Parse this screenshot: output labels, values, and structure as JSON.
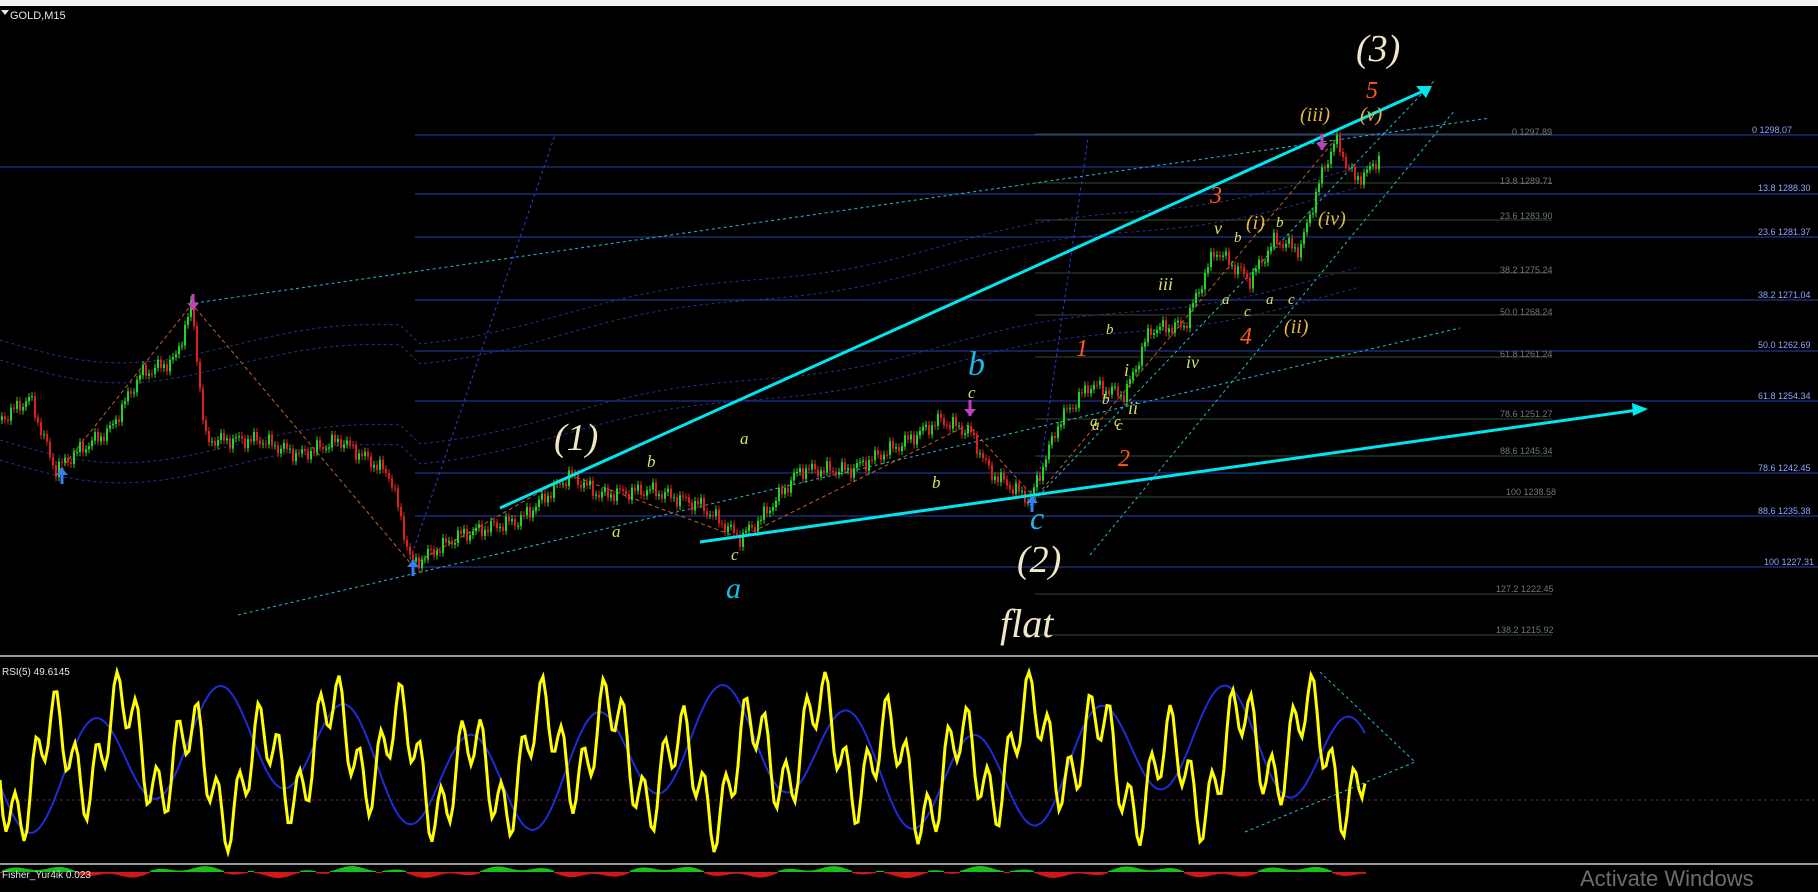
{
  "window": {
    "chart_title": "GOLD,M15",
    "rsi_title": "RSI(5) 49.6145",
    "fisher_title": "Fisher_Yur4ik 0.023",
    "watermark": "Activate Windows"
  },
  "colors": {
    "background": "#000000",
    "price_level_line": "#2c3fb0",
    "trend_channel": "#00e5ee",
    "rsi_line": "#ffff00",
    "wave_white": "#f0e6c8",
    "wave_blue": "#1cb8e8",
    "wave_orange": "#ff5a1e",
    "wave_yellow": "#e8b84a",
    "wave_olive": "#d6e06a",
    "arrow_blue": "#3b7df0",
    "arrow_purple": "#c040c0"
  },
  "fib_levels_right": [
    {
      "label": "0 1298.07"
    },
    {
      "label": "13.8 1288.30"
    },
    {
      "label": "23.6 1281.37"
    },
    {
      "label": "38.2 1271.04"
    },
    {
      "label": "50.0 1262.69"
    },
    {
      "label": "61.8 1254.34"
    },
    {
      "label": "78.6 1242.45"
    },
    {
      "label": "88.6 1235.38"
    },
    {
      "label": "100 1227.31"
    }
  ],
  "fib_levels_inner": [
    {
      "label": "0 1297.89"
    },
    {
      "label": "13.8 1289.71"
    },
    {
      "label": "23.6 1283.90"
    },
    {
      "label": "38.2 1275.24"
    },
    {
      "label": "50.0 1268.24"
    },
    {
      "label": "61.8 1261.24"
    },
    {
      "label": "78.6 1251.27"
    },
    {
      "label": "88.6 1245.34"
    },
    {
      "label": "100 1238.58"
    },
    {
      "label": "127.2 1222.45"
    },
    {
      "label": "138.2 1215.92"
    }
  ],
  "wave_labels": {
    "w1": "(1)",
    "w2": "(2)",
    "w3": "(3)",
    "flat": "flat",
    "a_big": "a",
    "b_big": "b",
    "c_big": "c",
    "o1": "1",
    "o2": "2",
    "o3": "3",
    "o4": "4",
    "o5": "5",
    "yi": "(i)",
    "yii": "(ii)",
    "yiii": "(iii)",
    "yiv": "(iv)",
    "yv": "(v)",
    "r_i": "i",
    "r_ii": "ii",
    "r_iii": "iii",
    "r_iv": "iv",
    "r_v": "v",
    "s_b1": "b",
    "s_a1": "a",
    "s_c1": "c",
    "s_a2": "a",
    "s_b2": "b",
    "s_c2": "c",
    "s_a3": "a",
    "s_c3": "c",
    "s_b3": "b",
    "s_a4": "a",
    "s_c4": "c",
    "s_b4": "b",
    "s_a5": "a",
    "s_c5": "c",
    "s_b5": "b",
    "s_b6": "b",
    "s_a6": "a",
    "s_c6": "c"
  }
}
